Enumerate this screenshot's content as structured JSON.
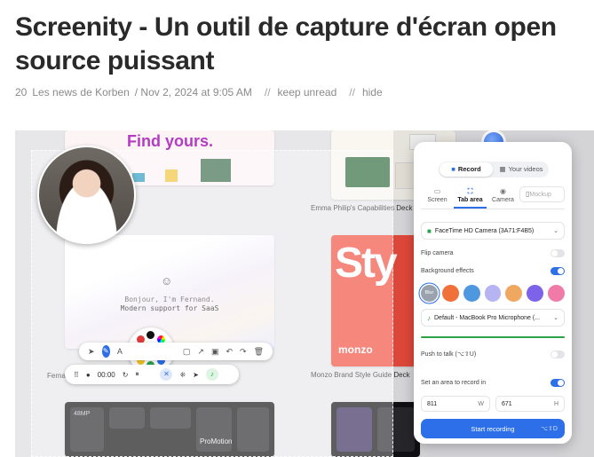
{
  "article": {
    "title": "Screenity - Un outil de capture d'écran open source puissant",
    "count": "20",
    "source": "Les news de Korben",
    "date": "/ Nov 2, 2024 at 9:05 AM",
    "sep": "//",
    "keep_unread": "keep unread",
    "hide": "hide"
  },
  "screenshot": {
    "find_yours": "Find yours.",
    "emma_label": "Emma Philip's Capabilities Deck",
    "fernand_l1": "Bonjour, I'm Fernand.",
    "fernand_l2": "Modern support for SaaS",
    "fernand_label": "Ferna",
    "monzo_word": "monzo",
    "monzo_sty": "Sty",
    "monzo_label": "Monzo Brand Style Guide Deck",
    "pro_motion": "ProMotion",
    "mp_label": "48MP",
    "rec_time": "00:00",
    "panel": {
      "record": "Record",
      "your_videos": "Your videos",
      "tabs": [
        "Screen",
        "Tab area",
        "Camera",
        "Mockup"
      ],
      "camera_device": "FaceTime HD Camera (3A71:F4B5)",
      "flip_camera": "Flip camera",
      "background_effects": "Background effects",
      "blur": "Blur",
      "microphone": "Default - MacBook Pro Microphone (...",
      "push_to_talk": "Push to talk (⌥⇧U)",
      "set_area": "Set an area to record in",
      "width": "811",
      "width_unit": "W",
      "height": "671",
      "height_unit": "H",
      "start": "Start recording",
      "start_kbd": "⌥⇧D",
      "effect_colors": [
        "#9aa3ad",
        "#f0703a",
        "#4f98e0",
        "#b6b4f2",
        "#f0a860",
        "#7d63ea",
        "#f07aa8"
      ],
      "accent": "#2c6fe8",
      "flip_camera_on": false,
      "background_effects_on": true,
      "push_to_talk_on": false,
      "set_area_on": true
    }
  }
}
